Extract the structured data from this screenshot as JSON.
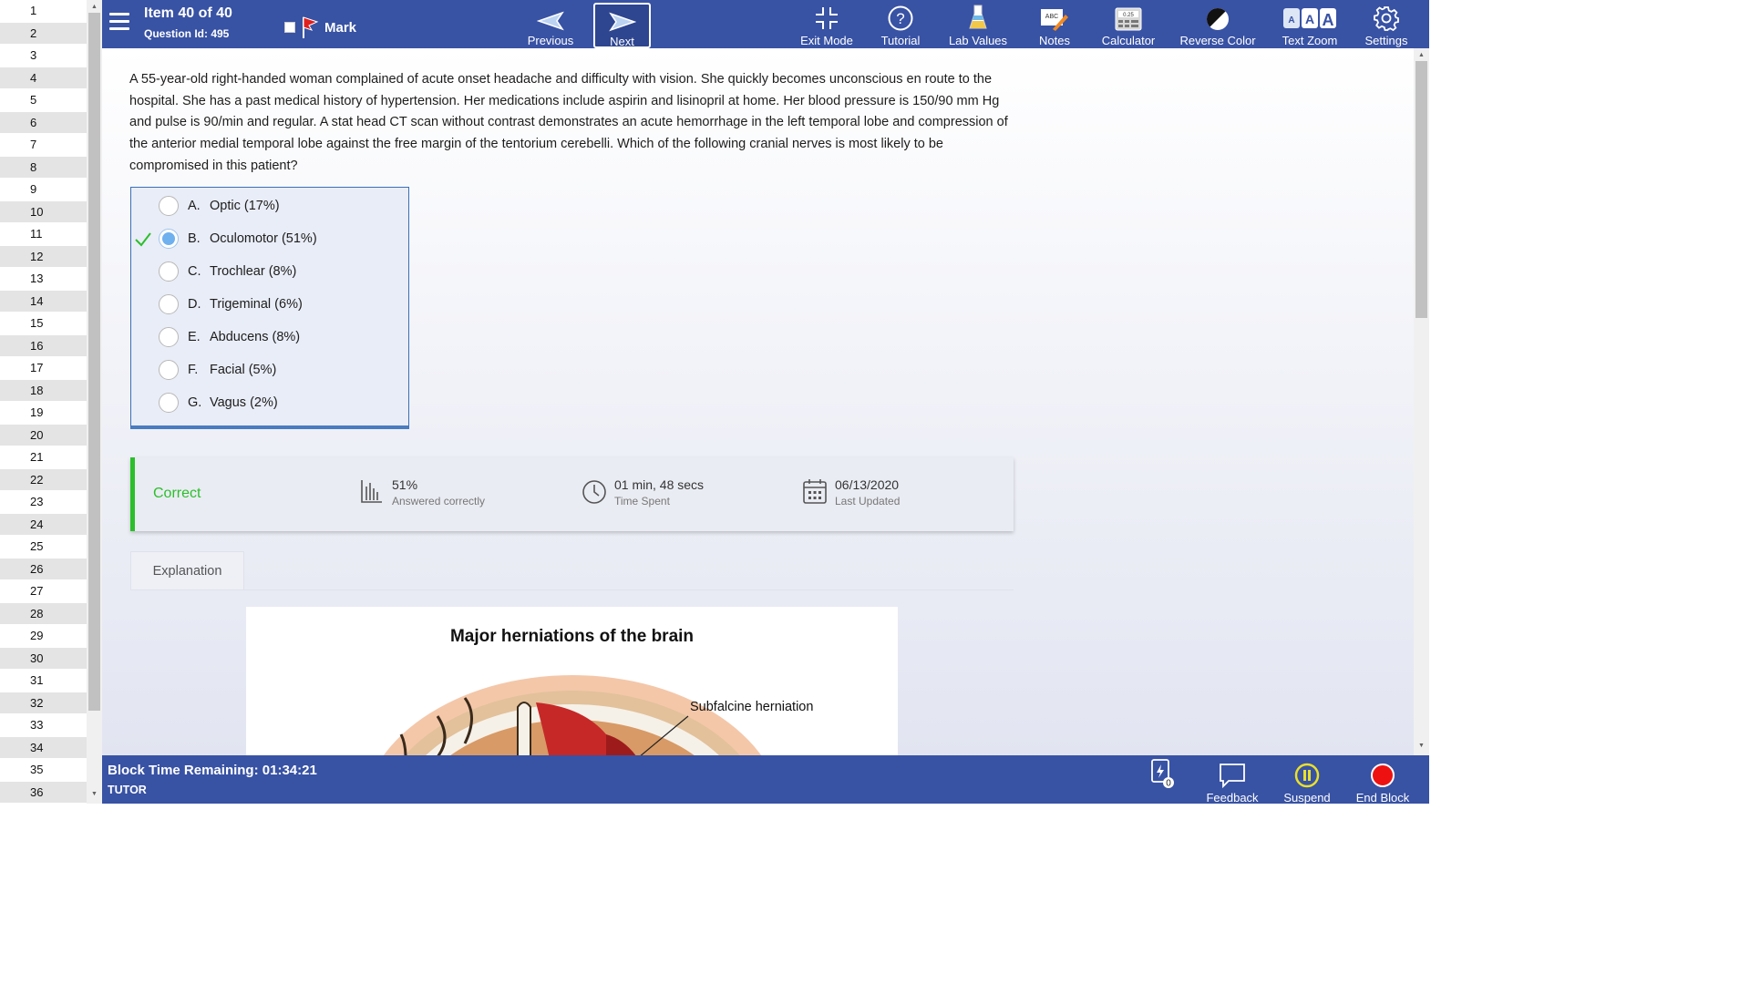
{
  "sidebar": {
    "items": [
      "1",
      "2",
      "3",
      "4",
      "5",
      "6",
      "7",
      "8",
      "9",
      "10",
      "11",
      "12",
      "13",
      "14",
      "15",
      "16",
      "17",
      "18",
      "19",
      "20",
      "21",
      "22",
      "23",
      "24",
      "25",
      "26",
      "27",
      "28",
      "29",
      "30",
      "31",
      "32",
      "33",
      "34",
      "35",
      "36"
    ]
  },
  "header": {
    "item_title": "Item 40 of 40",
    "question_id": "Question Id: 495",
    "mark_label": "Mark",
    "previous_label": "Previous",
    "next_label": "Next",
    "exit_mode_label": "Exit Mode",
    "tutorial_label": "Tutorial",
    "lab_values_label": "Lab Values",
    "notes_label": "Notes",
    "calculator_label": "Calculator",
    "calculator_display": "0.25",
    "reverse_color_label": "Reverse Color",
    "text_zoom_label": "Text Zoom",
    "settings_label": "Settings",
    "notes_icon_text": "ABC"
  },
  "question": {
    "text": "A 55-year-old right-handed woman complained of acute onset headache and difficulty with vision.  She quickly becomes unconscious en route to the hospital.  She has a past medical history of hypertension.  Her medications include aspirin and lisinopril at home.  Her blood pressure is 150/90 mm Hg and pulse is 90/min and regular.  A stat head CT scan without contrast demonstrates an acute hemorrhage in the left temporal lobe and compression of the anterior medial temporal lobe against the free margin of the tentorium cerebelli.  Which of the following cranial nerves is most likely to be compromised in this patient?"
  },
  "choices": [
    {
      "letter": "A.",
      "text": "Optic (17%)",
      "selected": false,
      "correct": false
    },
    {
      "letter": "B.",
      "text": "Oculomotor (51%)",
      "selected": true,
      "correct": true
    },
    {
      "letter": "C.",
      "text": "Trochlear (8%)",
      "selected": false,
      "correct": false
    },
    {
      "letter": "D.",
      "text": "Trigeminal (6%)",
      "selected": false,
      "correct": false
    },
    {
      "letter": "E.",
      "text": "Abducens (8%)",
      "selected": false,
      "correct": false
    },
    {
      "letter": "F.",
      "text": "Facial (5%)",
      "selected": false,
      "correct": false
    },
    {
      "letter": "G.",
      "text": "Vagus (2%)",
      "selected": false,
      "correct": false
    }
  ],
  "result": {
    "status": "Correct",
    "percent_value": "51%",
    "percent_label": "Answered correctly",
    "time_value": "01 min, 48 secs",
    "time_label": "Time Spent",
    "date_value": "06/13/2020",
    "date_label": "Last Updated"
  },
  "explanation": {
    "tab_label": "Explanation",
    "figure_title": "Major herniations of the brain",
    "figure_label": "Subfalcine herniation"
  },
  "footer": {
    "time_remaining": "Block Time Remaining: 01:34:21",
    "mode": "TUTOR",
    "flash_count": "0",
    "feedback_label": "Feedback",
    "suspend_label": "Suspend",
    "end_block_label": "End Block"
  },
  "colors": {
    "toolbar": "#3852a4",
    "correct_green": "#2bbf2b",
    "selected_radio": "#6fb0ef",
    "end_block_red": "#e11"
  }
}
